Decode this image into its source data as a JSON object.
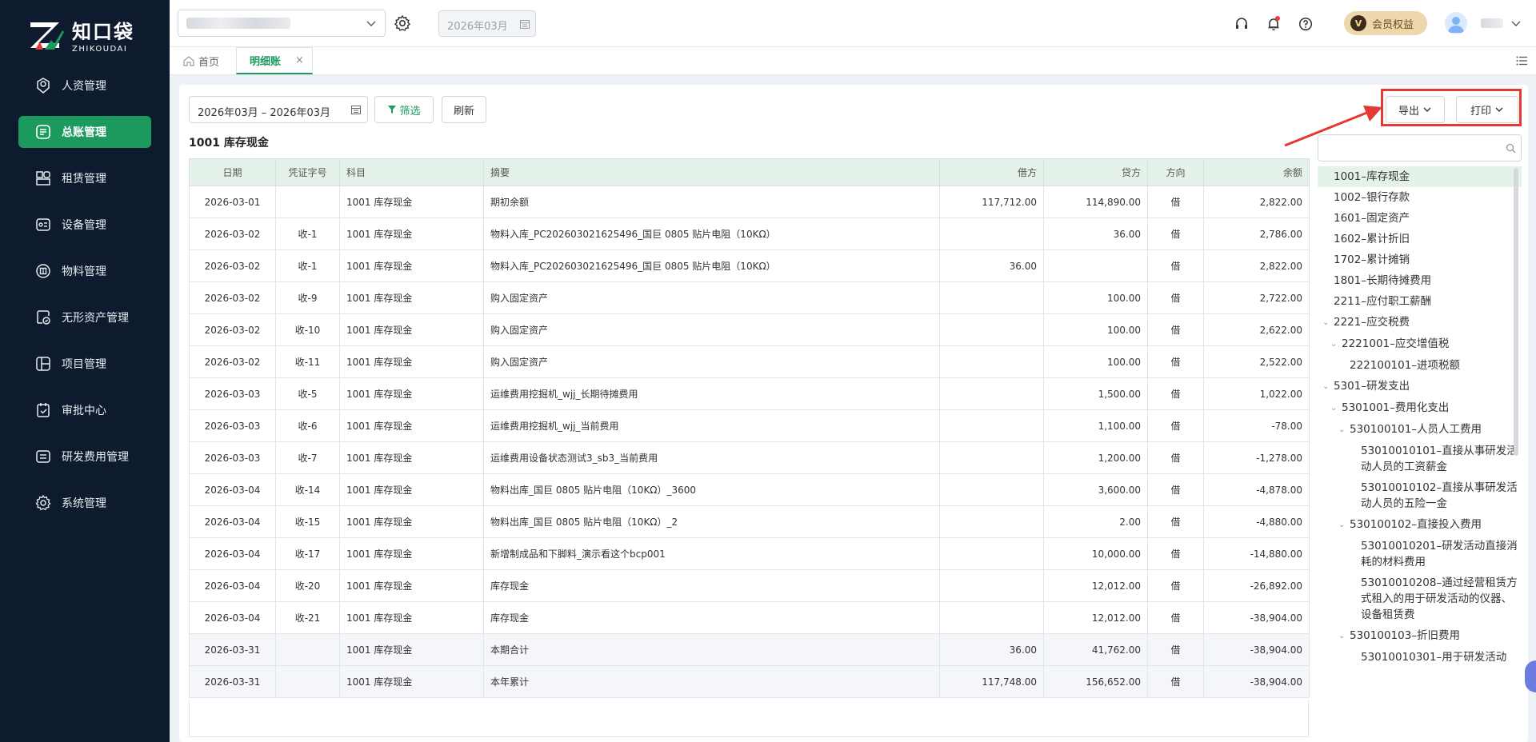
{
  "brand": {
    "name_cn": "知口袋",
    "name_en": "ZHIKOUDAI"
  },
  "sidebar": {
    "items": [
      {
        "label": "人资管理",
        "icon": "person-badge-icon",
        "active": false
      },
      {
        "label": "总账管理",
        "icon": "ledger-icon",
        "active": true
      },
      {
        "label": "租赁管理",
        "icon": "lease-icon",
        "active": false
      },
      {
        "label": "设备管理",
        "icon": "equipment-icon",
        "active": false
      },
      {
        "label": "物料管理",
        "icon": "material-icon",
        "active": false
      },
      {
        "label": "无形资产管理",
        "icon": "intangible-asset-icon",
        "active": false
      },
      {
        "label": "项目管理",
        "icon": "project-icon",
        "active": false
      },
      {
        "label": "审批中心",
        "icon": "approval-icon",
        "active": false
      },
      {
        "label": "研发费用管理",
        "icon": "rd-expense-icon",
        "active": false
      },
      {
        "label": "系统管理",
        "icon": "settings-icon",
        "active": false
      }
    ]
  },
  "header": {
    "period": "2026年03月",
    "member_label": "会员权益",
    "member_badge": "V"
  },
  "tabs": {
    "home": "首页",
    "current": "明细账",
    "close": "×"
  },
  "toolbar": {
    "date_range": "2026年03月 – 2026年03月",
    "filter_label": "筛选",
    "refresh_label": "刷新",
    "export_label": "导出",
    "print_label": "打印"
  },
  "ledger": {
    "title": "1001 库存现金",
    "columns": [
      "日期",
      "凭证字号",
      "科目",
      "摘要",
      "借方",
      "贷方",
      "方向",
      "余额"
    ],
    "rows": [
      {
        "date": "2026-03-01",
        "voucher": "",
        "account": "1001 库存现金",
        "summary": "期初余额",
        "debit": "117,712.00",
        "credit": "114,890.00",
        "dir": "借",
        "balance": "2,822.00",
        "sum": false
      },
      {
        "date": "2026-03-02",
        "voucher": "收-1",
        "account": "1001 库存现金",
        "summary": "物料入库_PC202603021625496_国巨 0805 贴片电阻（10KΩ）",
        "debit": "",
        "credit": "36.00",
        "dir": "借",
        "balance": "2,786.00",
        "sum": false
      },
      {
        "date": "2026-03-02",
        "voucher": "收-1",
        "account": "1001 库存现金",
        "summary": "物料入库_PC202603021625496_国巨 0805 贴片电阻（10KΩ）",
        "debit": "36.00",
        "credit": "",
        "dir": "借",
        "balance": "2,822.00",
        "sum": false
      },
      {
        "date": "2026-03-02",
        "voucher": "收-9",
        "account": "1001 库存现金",
        "summary": "购入固定资产",
        "debit": "",
        "credit": "100.00",
        "dir": "借",
        "balance": "2,722.00",
        "sum": false
      },
      {
        "date": "2026-03-02",
        "voucher": "收-10",
        "account": "1001 库存现金",
        "summary": "购入固定资产",
        "debit": "",
        "credit": "100.00",
        "dir": "借",
        "balance": "2,622.00",
        "sum": false
      },
      {
        "date": "2026-03-02",
        "voucher": "收-11",
        "account": "1001 库存现金",
        "summary": "购入固定资产",
        "debit": "",
        "credit": "100.00",
        "dir": "借",
        "balance": "2,522.00",
        "sum": false
      },
      {
        "date": "2026-03-03",
        "voucher": "收-5",
        "account": "1001 库存现金",
        "summary": "运维费用挖掘机_wjj_长期待摊费用",
        "debit": "",
        "credit": "1,500.00",
        "dir": "借",
        "balance": "1,022.00",
        "sum": false
      },
      {
        "date": "2026-03-03",
        "voucher": "收-6",
        "account": "1001 库存现金",
        "summary": "运维费用挖掘机_wjj_当前费用",
        "debit": "",
        "credit": "1,100.00",
        "dir": "借",
        "balance": "-78.00",
        "sum": false
      },
      {
        "date": "2026-03-03",
        "voucher": "收-7",
        "account": "1001 库存现金",
        "summary": "运维费用设备状态测试3_sb3_当前费用",
        "debit": "",
        "credit": "1,200.00",
        "dir": "借",
        "balance": "-1,278.00",
        "sum": false
      },
      {
        "date": "2026-03-04",
        "voucher": "收-14",
        "account": "1001 库存现金",
        "summary": "物料出库_国巨 0805 贴片电阻（10KΩ）_3600",
        "debit": "",
        "credit": "3,600.00",
        "dir": "借",
        "balance": "-4,878.00",
        "sum": false
      },
      {
        "date": "2026-03-04",
        "voucher": "收-15",
        "account": "1001 库存现金",
        "summary": "物料出库_国巨 0805 贴片电阻（10KΩ）_2",
        "debit": "",
        "credit": "2.00",
        "dir": "借",
        "balance": "-4,880.00",
        "sum": false
      },
      {
        "date": "2026-03-04",
        "voucher": "收-17",
        "account": "1001 库存现金",
        "summary": "新增制成品和下脚料_演示看这个bcp001",
        "debit": "",
        "credit": "10,000.00",
        "dir": "借",
        "balance": "-14,880.00",
        "sum": false
      },
      {
        "date": "2026-03-04",
        "voucher": "收-20",
        "account": "1001 库存现金",
        "summary": "库存现金",
        "debit": "",
        "credit": "12,012.00",
        "dir": "借",
        "balance": "-26,892.00",
        "sum": false
      },
      {
        "date": "2026-03-04",
        "voucher": "收-21",
        "account": "1001 库存现金",
        "summary": "库存现金",
        "debit": "",
        "credit": "12,012.00",
        "dir": "借",
        "balance": "-38,904.00",
        "sum": false
      },
      {
        "date": "2026-03-31",
        "voucher": "",
        "account": "1001 库存现金",
        "summary": "本期合计",
        "debit": "36.00",
        "credit": "41,762.00",
        "dir": "借",
        "balance": "-38,904.00",
        "sum": true
      },
      {
        "date": "2026-03-31",
        "voucher": "",
        "account": "1001 库存现金",
        "summary": "本年累计",
        "debit": "117,748.00",
        "credit": "156,652.00",
        "dir": "借",
        "balance": "-38,904.00",
        "sum": true
      }
    ]
  },
  "account_tree": [
    {
      "label": "1001–库存现金",
      "level": 0,
      "expandable": false,
      "active": true
    },
    {
      "label": "1002–银行存款",
      "level": 0,
      "expandable": false,
      "active": false
    },
    {
      "label": "1601–固定资产",
      "level": 0,
      "expandable": false,
      "active": false
    },
    {
      "label": "1602–累计折旧",
      "level": 0,
      "expandable": false,
      "active": false
    },
    {
      "label": "1702–累计摊销",
      "level": 0,
      "expandable": false,
      "active": false
    },
    {
      "label": "1801–长期待摊费用",
      "level": 0,
      "expandable": false,
      "active": false
    },
    {
      "label": "2211–应付职工薪酬",
      "level": 0,
      "expandable": false,
      "active": false
    },
    {
      "label": "2221–应交税费",
      "level": 0,
      "expandable": true,
      "active": false
    },
    {
      "label": "2221001–应交增值税",
      "level": 1,
      "expandable": true,
      "active": false
    },
    {
      "label": "222100101–进项税额",
      "level": 2,
      "expandable": false,
      "active": false
    },
    {
      "label": "5301–研发支出",
      "level": 0,
      "expandable": true,
      "active": false
    },
    {
      "label": "5301001–费用化支出",
      "level": 1,
      "expandable": true,
      "active": false
    },
    {
      "label": "530100101–人员人工费用",
      "level": 2,
      "expandable": true,
      "active": false
    },
    {
      "label": "53010010101–直接从事研发活动人员的工资薪金",
      "level": 3,
      "expandable": false,
      "active": false
    },
    {
      "label": "53010010102–直接从事研发活动人员的五险一金",
      "level": 3,
      "expandable": false,
      "active": false
    },
    {
      "label": "530100102–直接投入费用",
      "level": 2,
      "expandable": true,
      "active": false
    },
    {
      "label": "53010010201–研发活动直接消耗的材料费用",
      "level": 3,
      "expandable": false,
      "active": false
    },
    {
      "label": "53010010208–通过经营租赁方式租入的用于研发活动的仪器、设备租赁费",
      "level": 3,
      "expandable": false,
      "active": false
    },
    {
      "label": "530100103–折旧费用",
      "level": 2,
      "expandable": true,
      "active": false
    },
    {
      "label": "53010010301–用于研发活动",
      "level": 3,
      "expandable": false,
      "active": false
    }
  ],
  "colors": {
    "brand_green": "#1c9a5d",
    "sidebar_bg": "#0e1b2e",
    "highlight_red": "#e53935",
    "member_gold": "#efd7ad"
  }
}
